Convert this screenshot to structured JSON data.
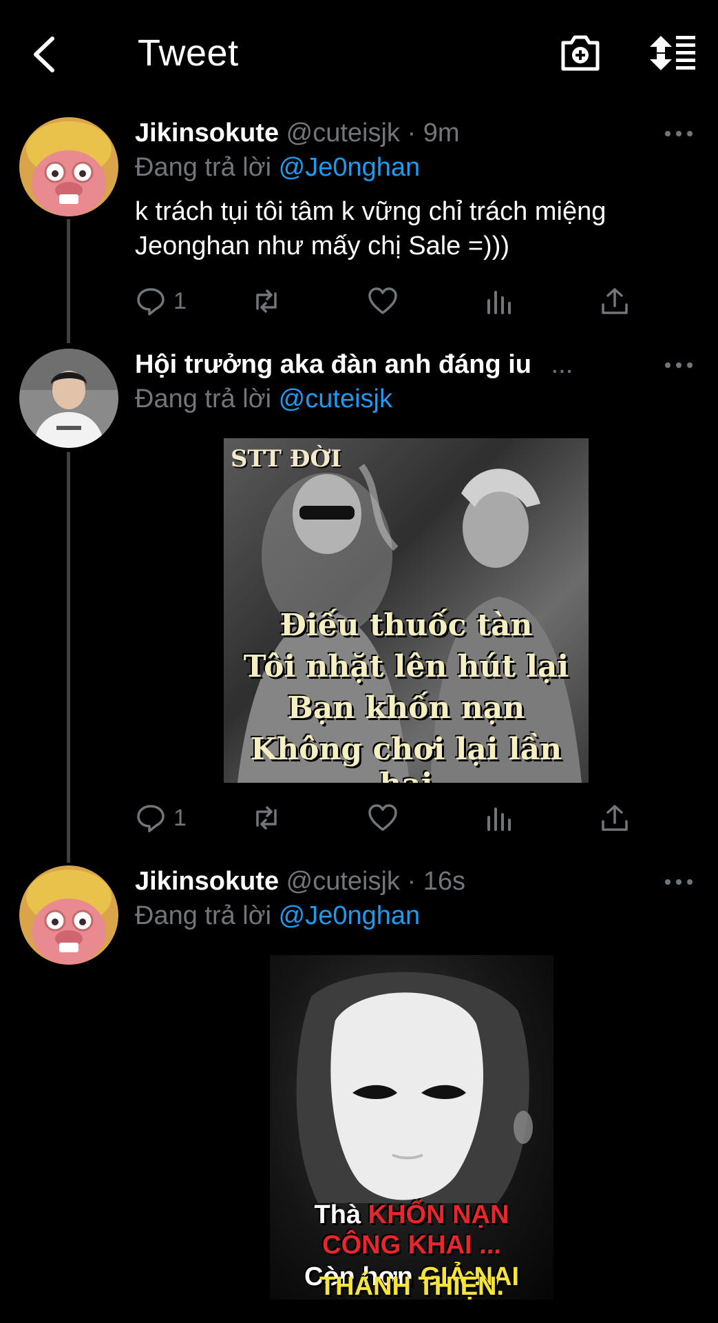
{
  "header": {
    "title": "Tweet",
    "back_icon": "chevron-left-icon",
    "camera_icon": "camera-add-icon",
    "sort_icon": "sort-list-icon"
  },
  "tweets": [
    {
      "name": "Jikinsokute",
      "handle": "@cuteisjk",
      "time": "· 9m",
      "reply_label": "Đang trả lời",
      "reply_to": "@Je0nghan",
      "text_line1": "k trách tụi tôi tâm k vững chỉ trách miệng",
      "text_line2": "Jeonghan như mấy chị Sale =)))",
      "reply_count": "1"
    },
    {
      "name": "Hội trưởng aka đàn anh đáng iu",
      "ellipsis": "...",
      "reply_label": "Đang trả lời",
      "reply_to": "@cuteisjk",
      "image": {
        "tag": "STT ĐỜI",
        "caption": [
          "Điếu thuốc tàn",
          "Tôi nhặt lên hút lại",
          "Bạn khốn nạn",
          "Không chơi lại lần hai"
        ]
      },
      "reply_count": "1"
    },
    {
      "name": "Jikinsokute",
      "handle": "@cuteisjk",
      "time": "· 16s",
      "reply_label": "Đang trả lời",
      "reply_to": "@Je0nghan",
      "image": {
        "line1_a": "Thà",
        "line1_b": "KHỐN NẠN",
        "line2": "CÔNG KHAI ...",
        "line3_a": "Còn hơn",
        "line3_b": "GIẢ NAI",
        "line4": "THÁNH THIỆN."
      }
    }
  ],
  "colors": {
    "background": "#000000",
    "text": "#ffffff",
    "muted": "#71767b",
    "link": "#1d9bf0",
    "thread_line": "#3e4144"
  }
}
